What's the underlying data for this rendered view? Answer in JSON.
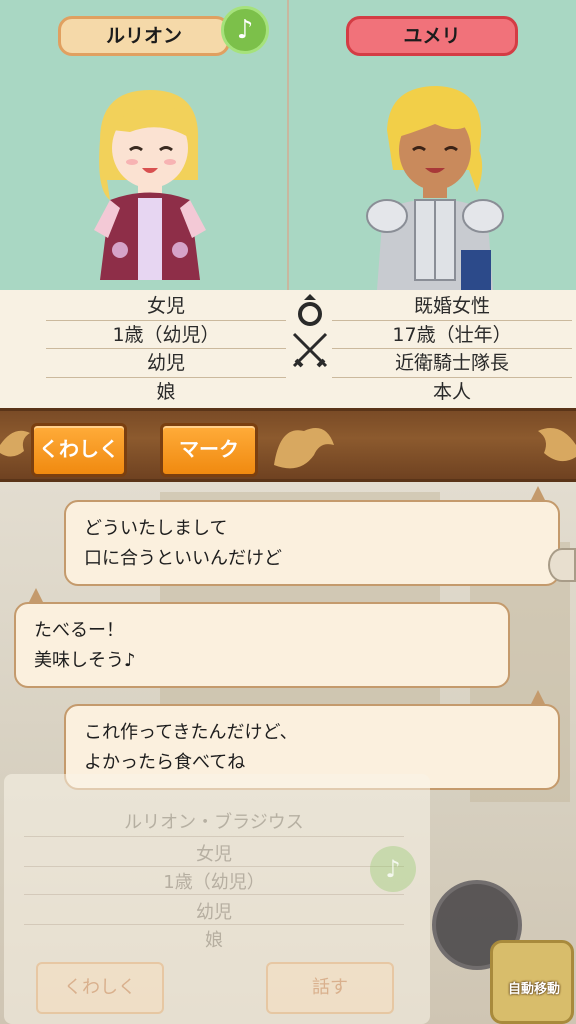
{
  "left_character": {
    "name": "ルリオン",
    "info": [
      "女児",
      "1歳（幼児）",
      "幼児",
      "娘"
    ]
  },
  "right_character": {
    "name": "ユメリ",
    "info": [
      "既婚女性",
      "17歳（壮年）",
      "近衛騎士隊長",
      "本人"
    ]
  },
  "music_icon": "♪",
  "actions": {
    "details_label": "くわしく",
    "mark_label": "マーク"
  },
  "chat": [
    {
      "lines": [
        "どういたしまして",
        "口に合うといいんだけど"
      ]
    },
    {
      "lines": [
        "たべるー！",
        "美味しそう♪"
      ]
    },
    {
      "lines": [
        "これ作ってきたんだけど、",
        "よかったら食べてね"
      ]
    }
  ],
  "background_panel": {
    "full_name": "ルリオン・ブラジウス",
    "info": [
      "女児",
      "1歳（幼児）",
      "幼児",
      "娘"
    ],
    "details_label": "くわしく",
    "talk_label": "話す"
  },
  "auto_move_label": "自動移動",
  "colors": {
    "portrait_bg": "#a9d7c3",
    "left_name_bg": "#f5d9a9",
    "right_name_bg": "#f1727a",
    "action_bar": "#8c5a2e",
    "orange_button": "#f59a20",
    "bubble_bg": "#fbf0de"
  }
}
